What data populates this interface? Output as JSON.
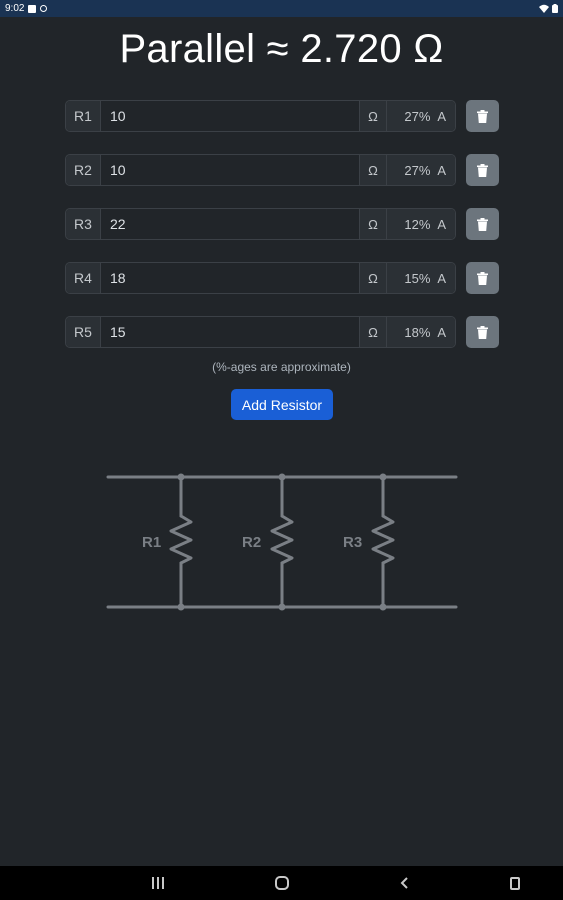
{
  "status_bar": {
    "time": "9:02"
  },
  "title": "Parallel ≈ 2.720 Ω",
  "resistors": [
    {
      "label": "R1",
      "value": "10",
      "unit": "Ω",
      "pct": "27% A"
    },
    {
      "label": "R2",
      "value": "10",
      "unit": "Ω",
      "pct": "27% A"
    },
    {
      "label": "R3",
      "value": "22",
      "unit": "Ω",
      "pct": "12% A"
    },
    {
      "label": "R4",
      "value": "18",
      "unit": "Ω",
      "pct": "15% A"
    },
    {
      "label": "R5",
      "value": "15",
      "unit": "Ω",
      "pct": "18% A"
    }
  ],
  "note": "(%-ages are approximate)",
  "add_button": "Add Resistor",
  "diagram": {
    "labels": [
      "R1",
      "R2",
      "R3"
    ]
  },
  "icons": {
    "delete": "trash-icon",
    "nav_recents": "recents-icon",
    "nav_home": "home-icon",
    "nav_back": "back-icon",
    "nav_rotate": "rotate-icon"
  },
  "colors": {
    "background": "#212529",
    "status_bar": "#1a3353",
    "primary": "#1a5fd6",
    "secondary": "#6c757d"
  }
}
